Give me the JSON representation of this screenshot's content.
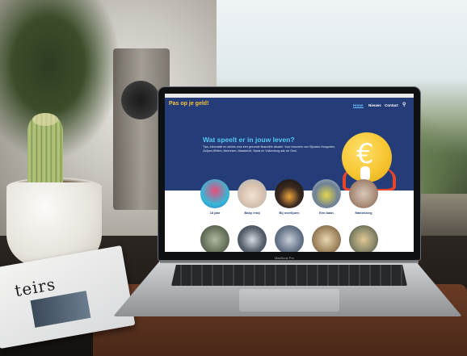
{
  "photo": {
    "newspaper_word": "teirs",
    "laptop_label": "MacBook Pro"
  },
  "site": {
    "logo": "Pas op je geld!",
    "nav": {
      "home": "Home",
      "nieuws": "Nieuws",
      "contact": "Contact"
    },
    "hero": {
      "title": "Wat speelt er in jouw leven?",
      "text": "Tips, informatie en advies voor een gezonde financiële situatie. Voor inwoners van Gijsdam-Hoogvelen, Zuiljum-Willem, Meeresen, Maastricht, Stads en Volkenburg aan de Geul."
    },
    "categories_row1": [
      {
        "label": "18 jaar"
      },
      {
        "label": "Baby erbij"
      },
      {
        "label": "Bij overlijden"
      },
      {
        "label": "Een baan"
      },
      {
        "label": "Mantelzorg"
      }
    ],
    "categories_row2": [
      {
        "label": ""
      },
      {
        "label": ""
      },
      {
        "label": ""
      },
      {
        "label": ""
      },
      {
        "label": ""
      }
    ],
    "colors": {
      "header_bg": "#243d78",
      "logo": "#f7c33e",
      "accent": "#59c7f4",
      "coin": "#f7c633"
    }
  },
  "icons": {
    "search": "search-icon",
    "coin": "euro-coin-icon"
  }
}
